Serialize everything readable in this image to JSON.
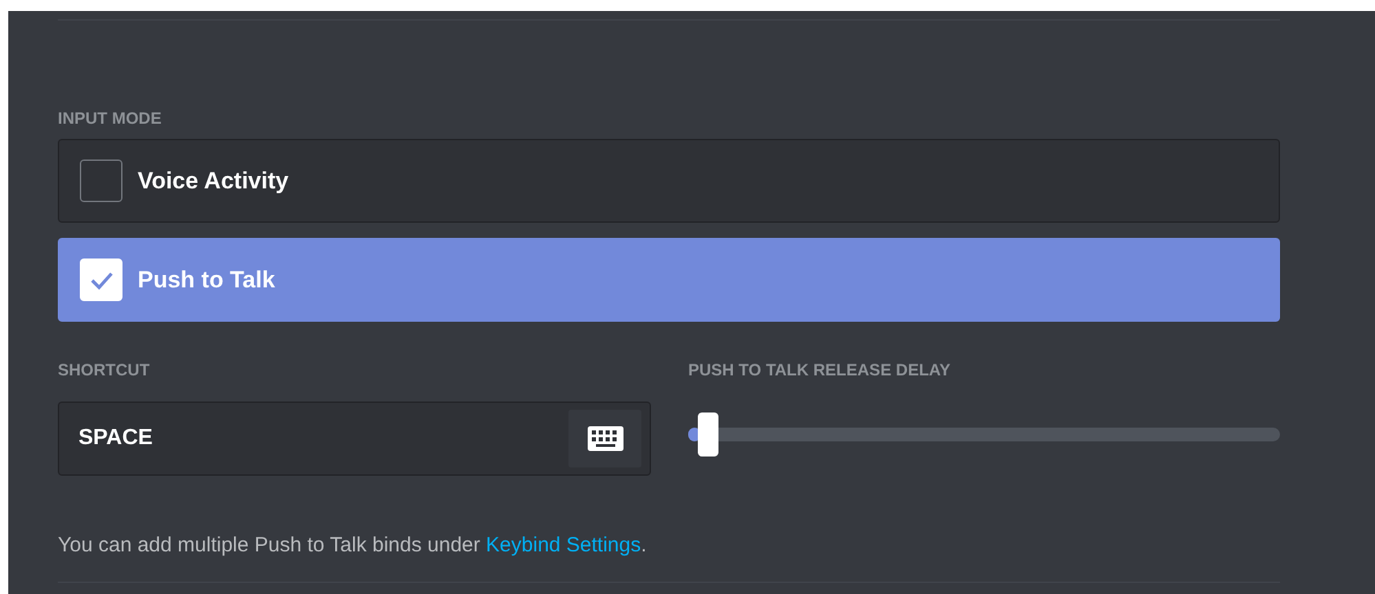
{
  "input_mode": {
    "label": "INPUT MODE",
    "options": [
      {
        "label": "Voice Activity",
        "selected": false
      },
      {
        "label": "Push to Talk",
        "selected": true
      }
    ]
  },
  "shortcut": {
    "label": "SHORTCUT",
    "value": "SPACE"
  },
  "release_delay": {
    "label": "PUSH TO TALK RELEASE DELAY",
    "level": 0.02
  },
  "note": {
    "text": "You can add multiple Push to Talk binds under ",
    "link": "Keybind Settings",
    "after": "."
  }
}
